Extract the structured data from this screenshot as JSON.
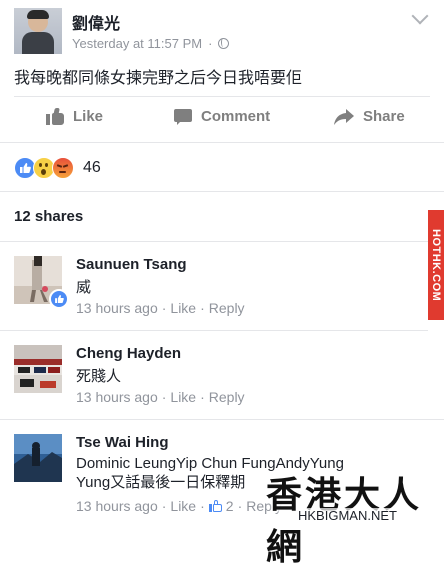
{
  "post": {
    "author": "劉偉光",
    "timestamp": "Yesterday at 11:57 PM",
    "meta_separator": "·",
    "text": "我每晚都同條女揀完野之后今日我唔要佢",
    "audience_icon": "globe-icon",
    "menu_icon": "chevron-down-icon"
  },
  "actions": {
    "like": "Like",
    "comment": "Comment",
    "share": "Share"
  },
  "reactions": {
    "icons": [
      "like-icon",
      "wow-icon",
      "angry-icon"
    ],
    "count": "46"
  },
  "shares_text": "12 shares",
  "comments": [
    {
      "name": "Saunuen Tsang",
      "text": "威",
      "time": "13 hours ago",
      "like": "Like",
      "reply": "Reply"
    },
    {
      "name": "Cheng Hayden",
      "text": "死賤人",
      "time": "13 hours ago",
      "like": "Like",
      "reply": "Reply"
    },
    {
      "name": "Tse Wai Hing",
      "text": "Dominic LeungYip Chun FungAndyYung Yung又話最後一日保釋期",
      "text_line1": "Dominic LeungYip Chun FungAndyYung",
      "text_line2": "Yung又話最後一日保釋期",
      "time": "13 hours ago",
      "like": "Like",
      "like_count": "2",
      "reply": "Reply"
    }
  ],
  "watermarks": {
    "side": "HOTHK.COM",
    "big": "香港大人網",
    "url": "HKBIGMAN.NET"
  },
  "colors": {
    "accent": "#4c8bf5",
    "text": "#1d2129",
    "muted": "#90949c",
    "divider": "#e5e6e9",
    "watermark_red": "#e03a2f"
  }
}
